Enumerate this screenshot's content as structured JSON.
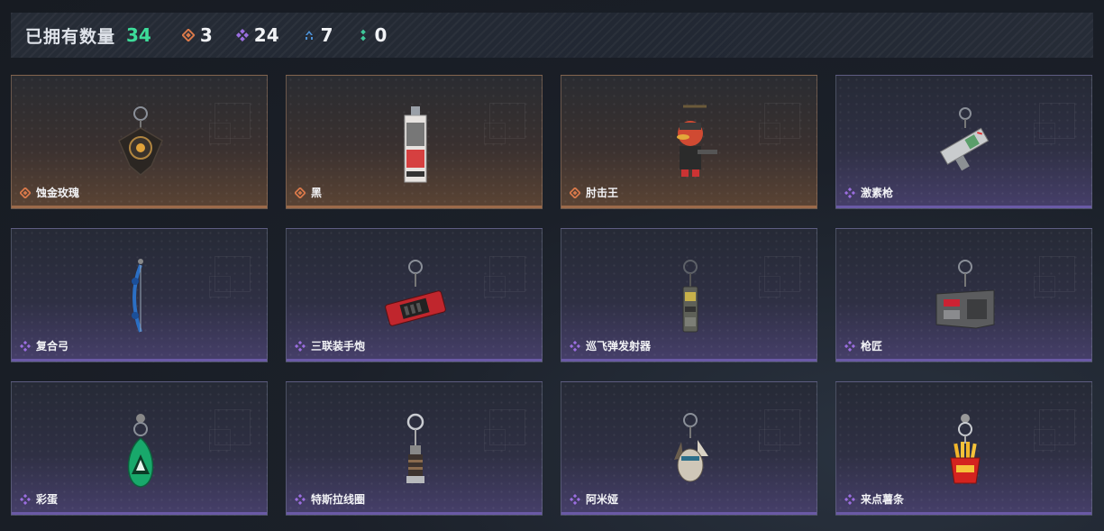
{
  "header": {
    "owned_label": "已拥有数量",
    "owned_count": "34",
    "stats": [
      {
        "icon": "orange-diamond-icon",
        "value": "3",
        "color": "#d9794a"
      },
      {
        "icon": "purple-diamond-icon",
        "value": "24",
        "color": "#9b6ee0"
      },
      {
        "icon": "blue-chevron-icon",
        "value": "7",
        "color": "#4c92d8"
      },
      {
        "icon": "green-dots-icon",
        "value": "0",
        "color": "#3fc99a"
      }
    ]
  },
  "items": [
    {
      "name": "蚀金玫瑰",
      "rarity": "orange",
      "icon": "gold-rose-charm-icon"
    },
    {
      "name": "黑",
      "rarity": "orange",
      "icon": "black-card-charm-icon"
    },
    {
      "name": "肘击王",
      "rarity": "orange",
      "icon": "duck-soldier-charm-icon"
    },
    {
      "name": "激素枪",
      "rarity": "purple",
      "icon": "syringe-gun-charm-icon"
    },
    {
      "name": "复合弓",
      "rarity": "purple",
      "icon": "compound-bow-charm-icon"
    },
    {
      "name": "三联装手炮",
      "rarity": "purple",
      "icon": "triple-hand-cannon-charm-icon"
    },
    {
      "name": "巡飞弹发射器",
      "rarity": "purple",
      "icon": "loitering-launcher-charm-icon"
    },
    {
      "name": "枪匠",
      "rarity": "purple",
      "icon": "gunsmith-charm-icon"
    },
    {
      "name": "彩蛋",
      "rarity": "purple",
      "icon": "easter-egg-charm-icon"
    },
    {
      "name": "特斯拉线圈",
      "rarity": "purple",
      "icon": "tesla-coil-charm-icon"
    },
    {
      "name": "阿米娅",
      "rarity": "purple",
      "icon": "amiya-charm-icon"
    },
    {
      "name": "来点薯条",
      "rarity": "purple",
      "icon": "fries-charm-icon"
    }
  ]
}
